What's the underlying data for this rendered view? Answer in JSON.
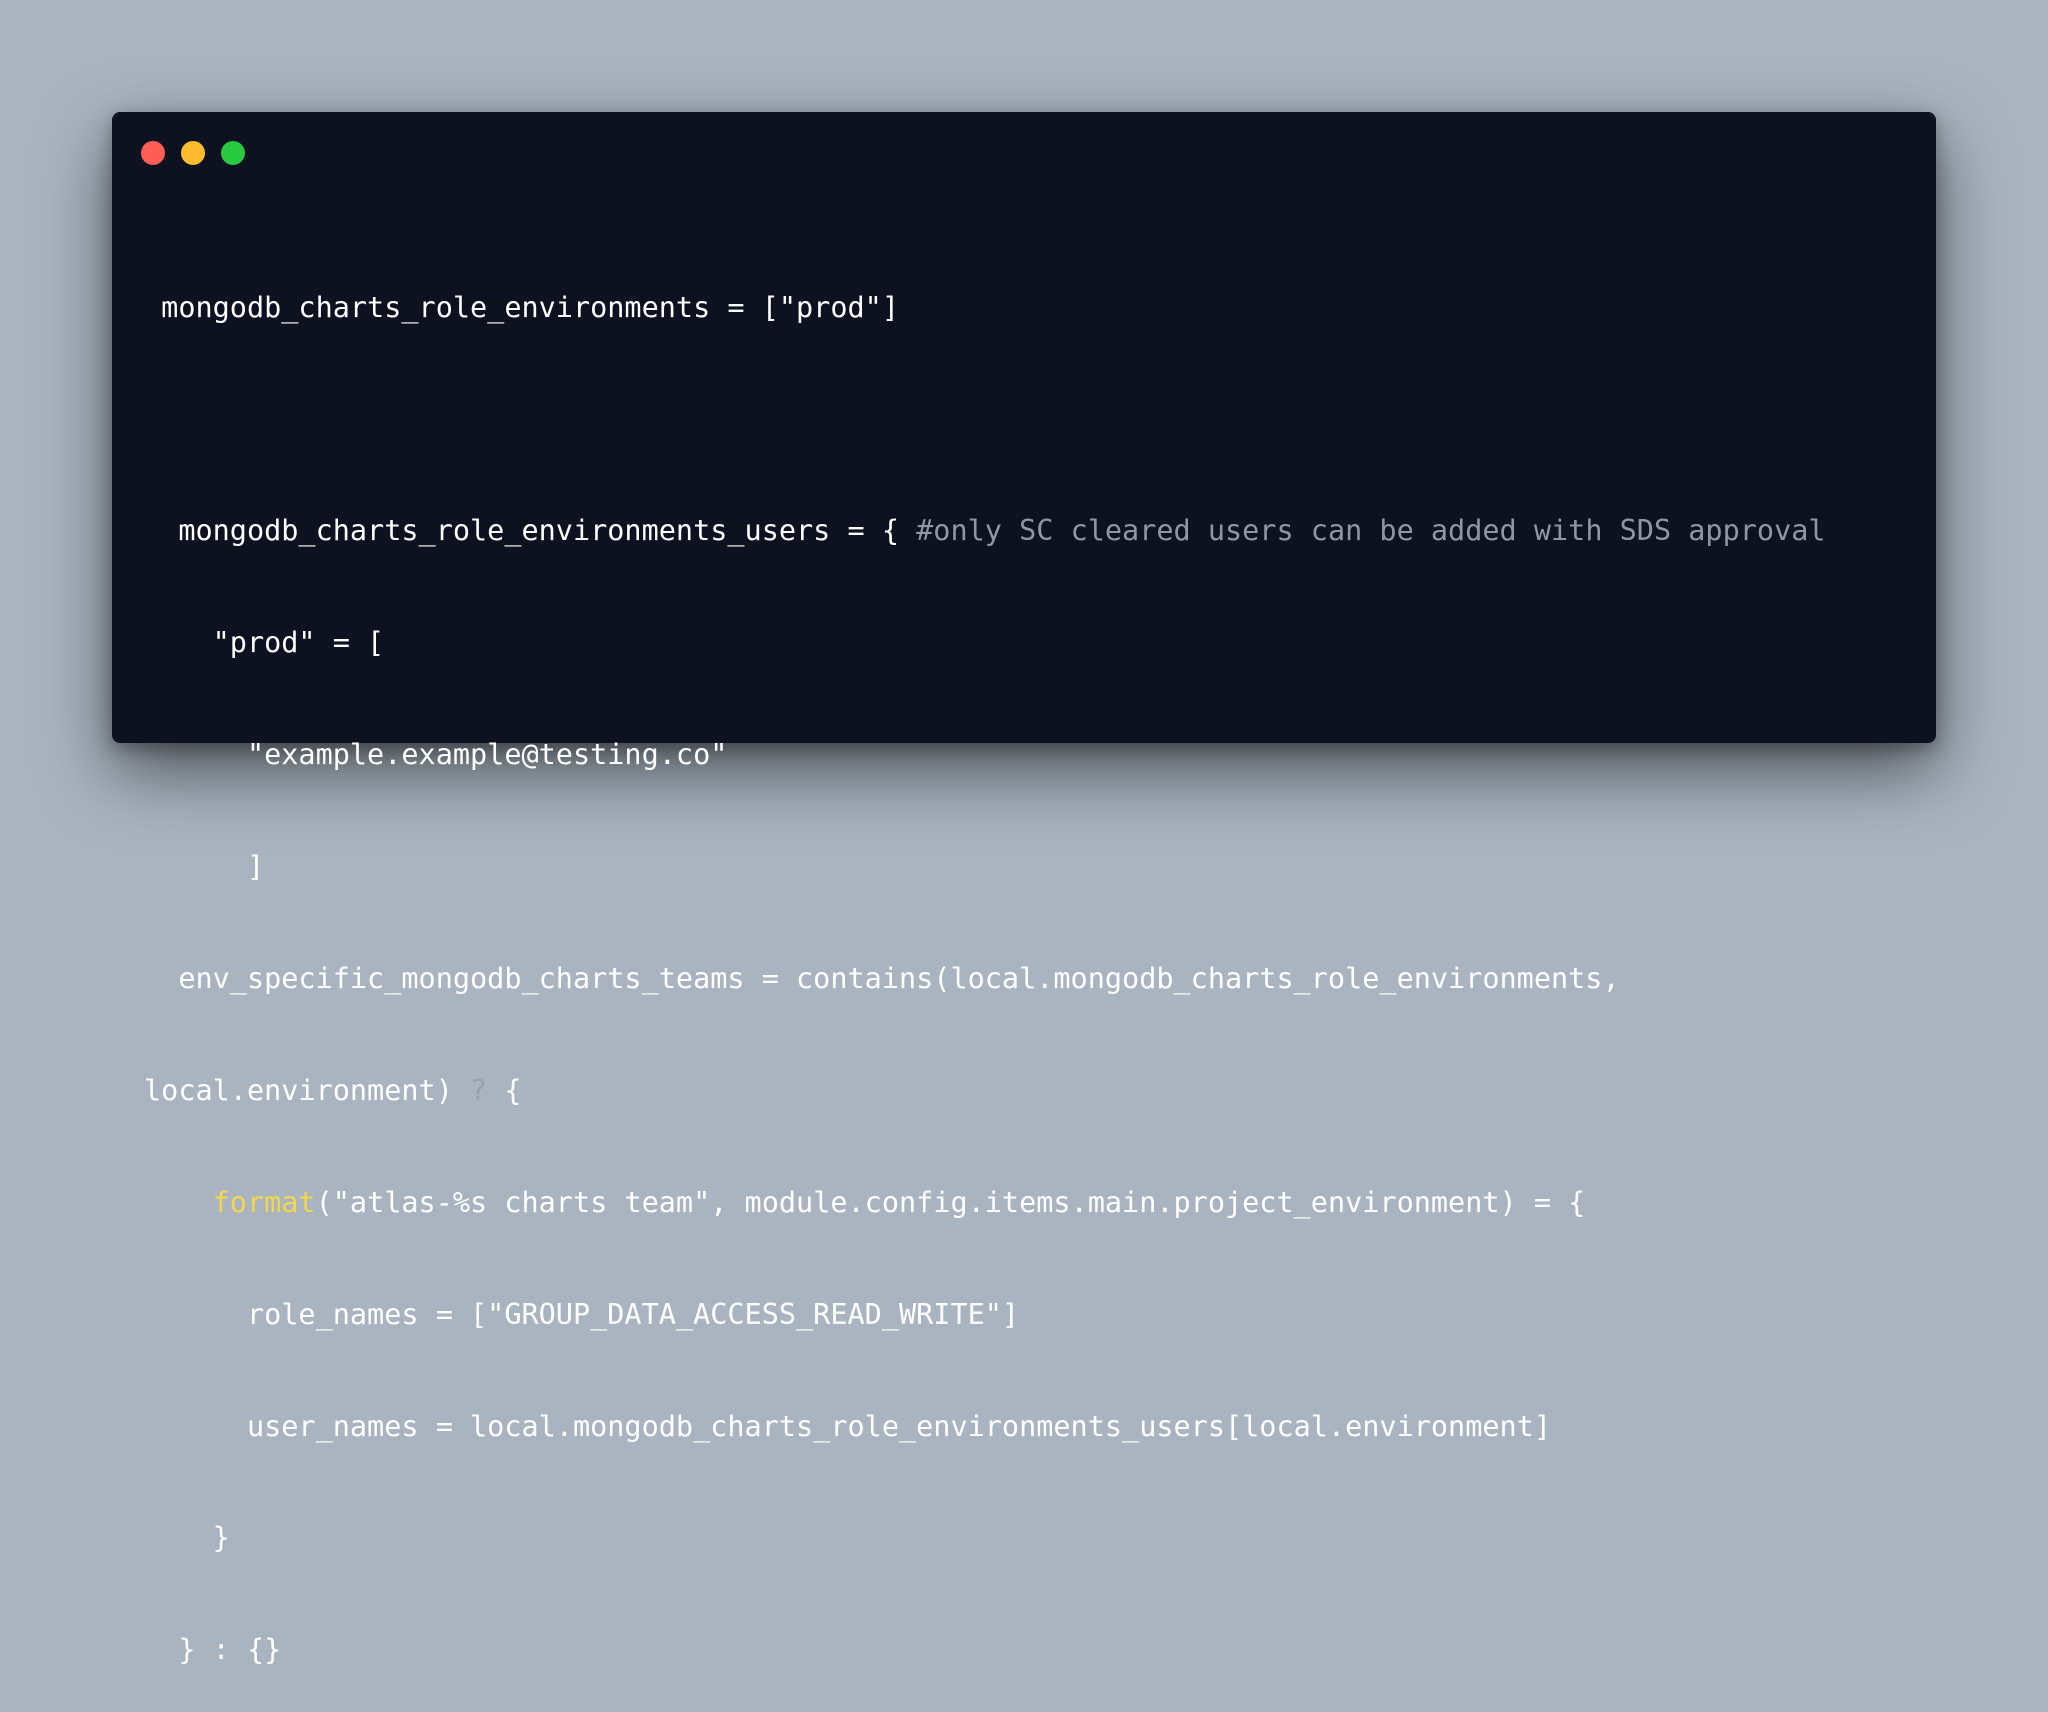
{
  "window": {
    "controls": {
      "close": "close-button",
      "minimize": "minimize-button",
      "zoom": "zoom-button"
    }
  },
  "colors": {
    "page_background": "#a9b4c0",
    "window_background": "#0d1120",
    "text": "#ffffff",
    "comment": "#9097a4",
    "function": "#f2d64b",
    "close": "#ff5f57",
    "minimize": "#febc2e",
    "zoom": "#28c840"
  },
  "code": {
    "l1": " mongodb_charts_role_environments = [\"prod\"]",
    "l3_main": "  mongodb_charts_role_environments_users = { ",
    "l3_comment": "#only SC cleared users can be added with SDS approval",
    "l4": "    \"prod\" = [",
    "l5": "      \"example.example@testing.co\"",
    "l6": "      ]",
    "l7": "  env_specific_mongodb_charts_teams = contains(local.mongodb_charts_role_environments,",
    "l8_a": "local.environment) ",
    "l8_q": "?",
    "l8_b": " {",
    "l9_indent": "    ",
    "l9_fn": "format",
    "l9_rest": "(\"atlas-%s charts team\", module.config.items.main.project_environment) = {",
    "l10": "      role_names = [\"GROUP_DATA_ACCESS_READ_WRITE\"]",
    "l11": "      user_names = local.mongodb_charts_role_environments_users[local.environment]",
    "l12": "    }",
    "l13": "  } : {}"
  }
}
